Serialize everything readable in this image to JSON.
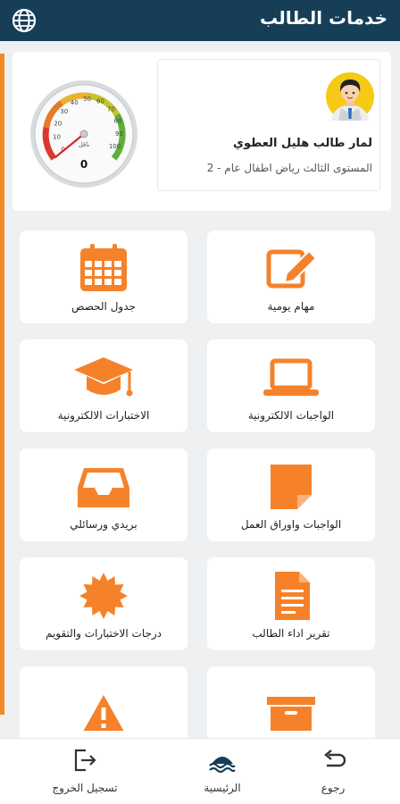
{
  "header": {
    "title": "خدمات الطالب",
    "language_icon": "globe-icon"
  },
  "profile": {
    "name": "لمار طالب هليل العطوي",
    "level": "المستوى الثالث رياض اطفال عام - 2",
    "avatar_icon": "student-avatar"
  },
  "gauge": {
    "ticks": [
      "0",
      "10",
      "20",
      "30",
      "40",
      "50",
      "60",
      "70",
      "80",
      "90",
      "100"
    ],
    "caption": "ناقل",
    "value": "0"
  },
  "tiles": [
    {
      "label": "مهام يومية",
      "icon": "edit-icon"
    },
    {
      "label": "جدول الحصص",
      "icon": "calendar-icon"
    },
    {
      "label": "الواجبات الالكترونية",
      "icon": "laptop-icon"
    },
    {
      "label": "الاختبارات الالكترونية",
      "icon": "graduation-cap-icon"
    },
    {
      "label": "الواجبات واوراق العمل",
      "icon": "note-icon"
    },
    {
      "label": "بريدي ورسائلي",
      "icon": "inbox-icon"
    },
    {
      "label": "تقرير اداء الطالب",
      "icon": "document-icon"
    },
    {
      "label": "درجات الاختبارات والتقويم",
      "icon": "badge-icon"
    },
    {
      "label": "",
      "icon": "archive-icon"
    },
    {
      "label": "",
      "icon": "warning-icon"
    }
  ],
  "bottom_nav": {
    "back": "رجوع",
    "home": "الرئيسية",
    "logout": "تسجيل الخروج"
  },
  "colors": {
    "header": "#163e57",
    "accent": "#f5822a",
    "background": "#eef0f2"
  }
}
